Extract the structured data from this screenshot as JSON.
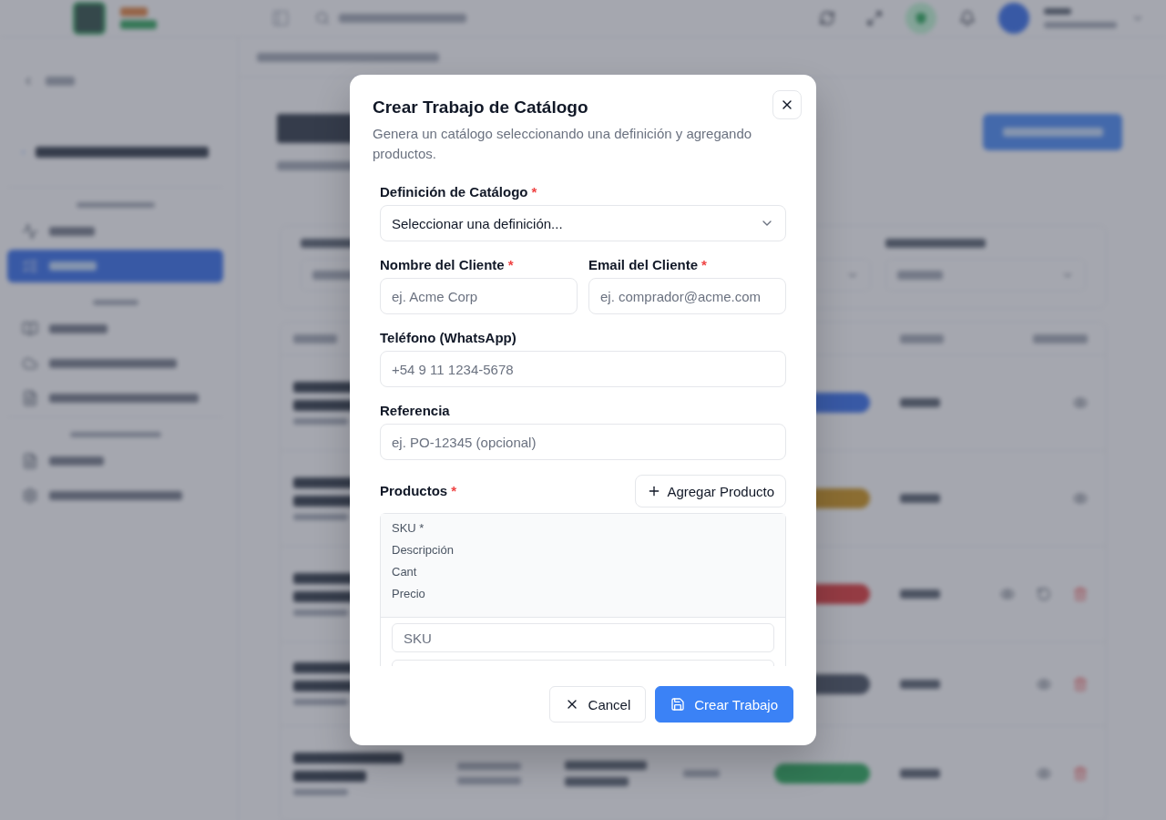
{
  "dialog": {
    "title": "Crear Trabajo de Catálogo",
    "description": "Genera un catálogo seleccionando una definición y agregando productos.",
    "fields": [
      {
        "kind": "select",
        "label": "Definición de Catálogo",
        "mark": "*",
        "value": "Seleccionar una definición..."
      },
      {
        "kind": "pair",
        "fields": [
          {
            "kind": "input",
            "label": "Nombre del Cliente",
            "mark": "*",
            "placeholder": "ej. Acme Corp"
          },
          {
            "kind": "input",
            "label": "Email del Cliente",
            "mark": "*",
            "placeholder": "ej. comprador@acme.com"
          }
        ]
      },
      {
        "kind": "input",
        "label": "Teléfono (WhatsApp)",
        "placeholder": "+54 9 11 1234-5678"
      },
      {
        "kind": "input",
        "label": "Referencia",
        "placeholder": "ej. PO-12345 (opcional)"
      }
    ],
    "products": {
      "label": "Productos",
      "mark": "*",
      "add_button": "Agregar Producto",
      "columns": [
        "SKU *",
        "Descripción",
        "Cant",
        "Precio"
      ],
      "row_fields": [
        {
          "kind": "input",
          "placeholder": "SKU"
        },
        {
          "kind": "input"
        }
      ]
    },
    "buttons": [
      {
        "label": "Cancel",
        "kind": "secondary"
      },
      {
        "label": "Crear Trabajo",
        "kind": "primary"
      }
    ]
  }
}
